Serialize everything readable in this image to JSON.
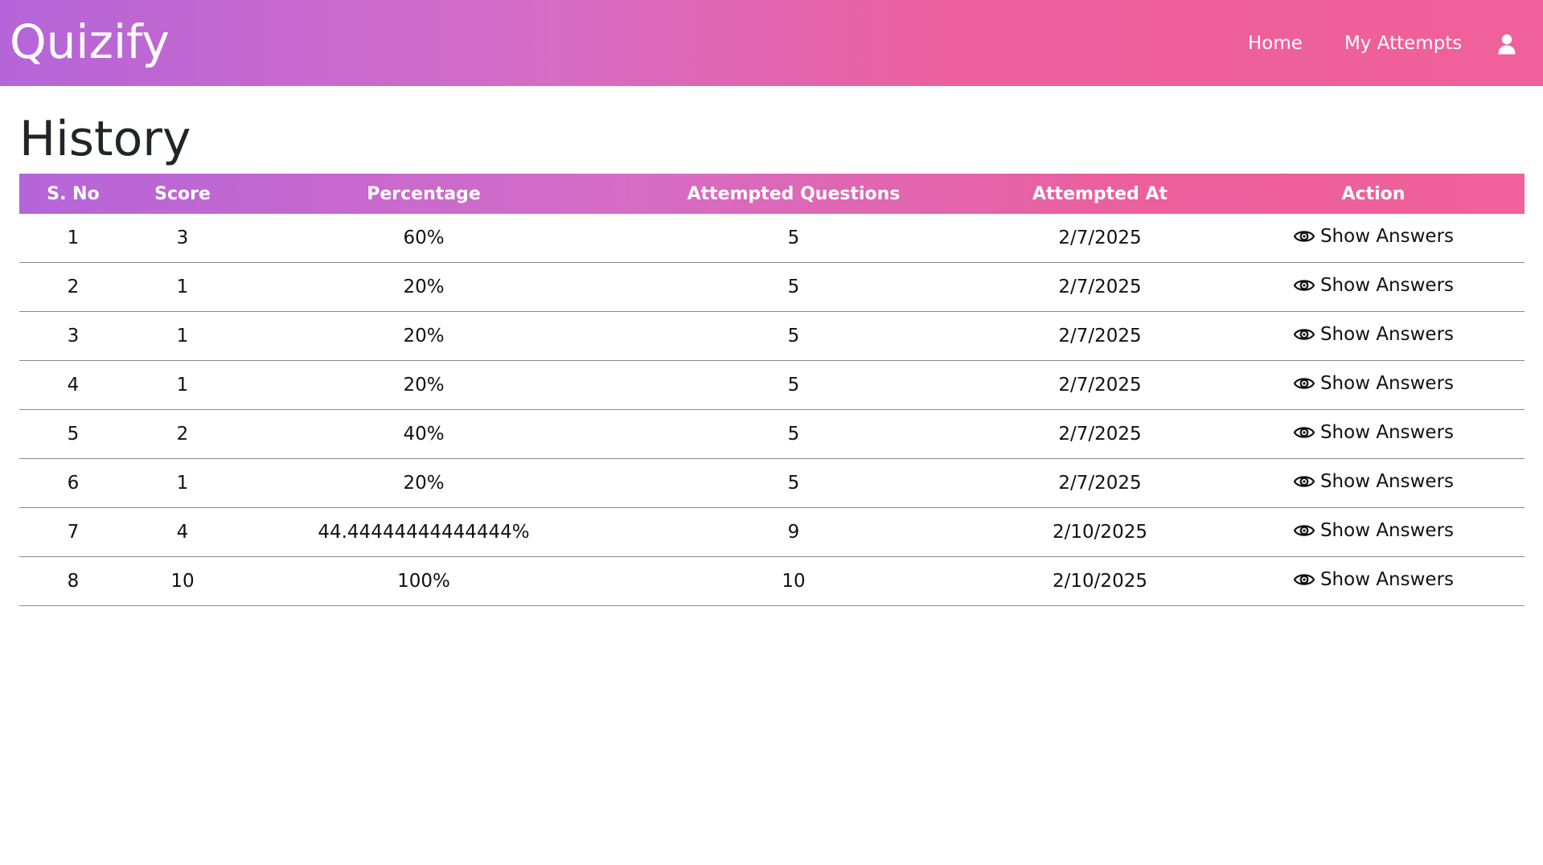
{
  "navbar": {
    "brand": "Quizify",
    "links": [
      "Home",
      "My Attempts"
    ],
    "user_icon": "user-icon"
  },
  "page": {
    "title": "History"
  },
  "table": {
    "headers": [
      "S. No",
      "Score",
      "Percentage",
      "Attempted Questions",
      "Attempted At",
      "Action"
    ],
    "action_icon": "eye-icon",
    "rows": [
      {
        "sno": "1",
        "score": "3",
        "percentage": "60%",
        "attempted_questions": "5",
        "attempted_at": "2/7/2025",
        "action": "Show Answers"
      },
      {
        "sno": "2",
        "score": "1",
        "percentage": "20%",
        "attempted_questions": "5",
        "attempted_at": "2/7/2025",
        "action": "Show Answers"
      },
      {
        "sno": "3",
        "score": "1",
        "percentage": "20%",
        "attempted_questions": "5",
        "attempted_at": "2/7/2025",
        "action": "Show Answers"
      },
      {
        "sno": "4",
        "score": "1",
        "percentage": "20%",
        "attempted_questions": "5",
        "attempted_at": "2/7/2025",
        "action": "Show Answers"
      },
      {
        "sno": "5",
        "score": "2",
        "percentage": "40%",
        "attempted_questions": "5",
        "attempted_at": "2/7/2025",
        "action": "Show Answers"
      },
      {
        "sno": "6",
        "score": "1",
        "percentage": "20%",
        "attempted_questions": "5",
        "attempted_at": "2/7/2025",
        "action": "Show Answers"
      },
      {
        "sno": "7",
        "score": "4",
        "percentage": "44.44444444444444%",
        "attempted_questions": "9",
        "attempted_at": "2/10/2025",
        "action": "Show Answers"
      },
      {
        "sno": "8",
        "score": "10",
        "percentage": "100%",
        "attempted_questions": "10",
        "attempted_at": "2/10/2025",
        "action": "Show Answers"
      }
    ]
  },
  "colors": {
    "gradient_start": "#b565d9",
    "gradient_mid": "#d56cc5",
    "gradient_end": "#f0609a",
    "title_text": "#212529",
    "row_border": "#8a8a8a"
  }
}
